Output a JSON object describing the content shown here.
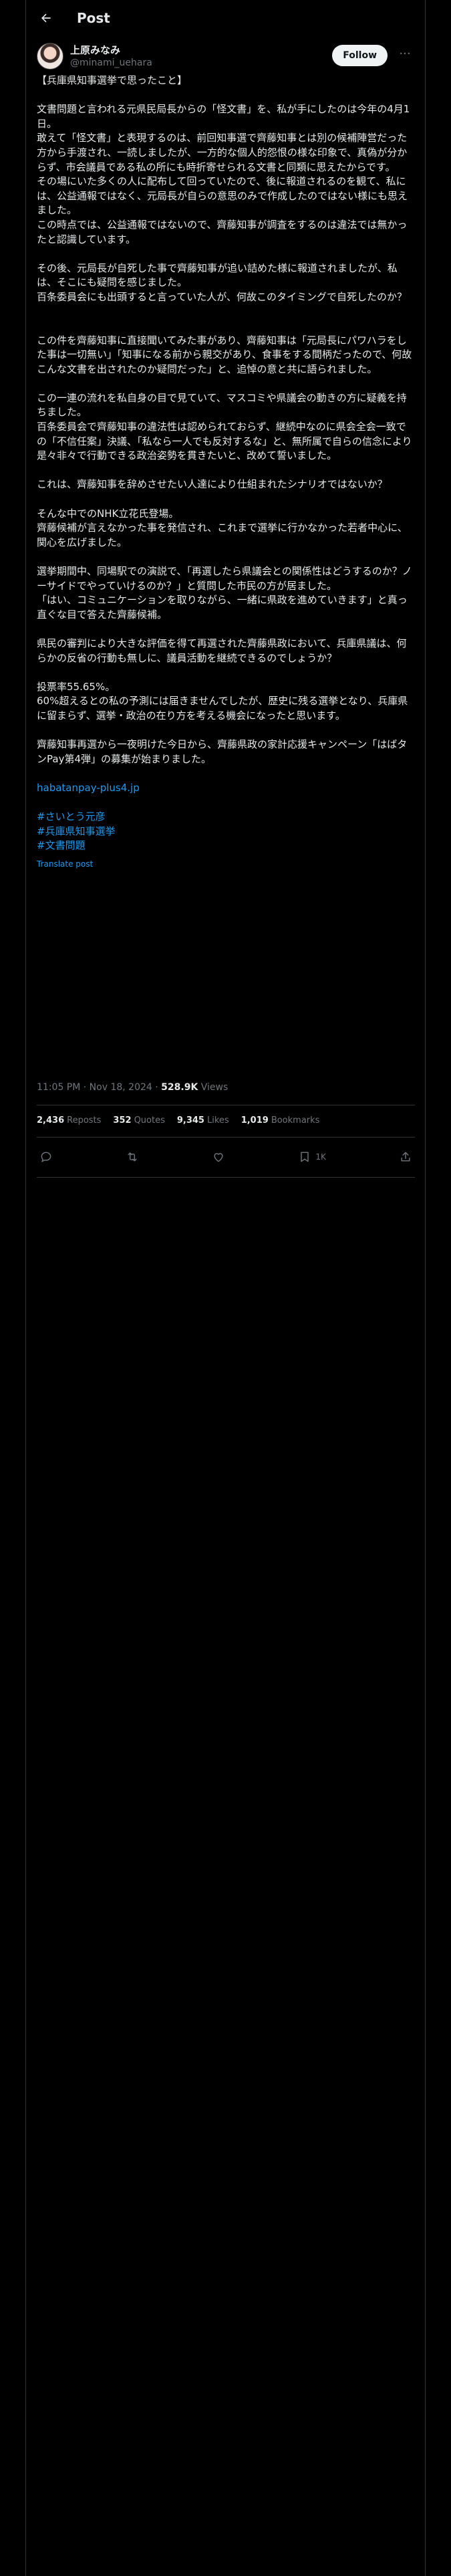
{
  "header": {
    "title": "Post"
  },
  "author": {
    "display_name": "上原みなみ",
    "handle": "@minami_uehara",
    "follow_label": "Follow",
    "more_label": "···"
  },
  "body": {
    "p1": "【兵庫県知事選挙で思ったこと】",
    "p2": "文書問題と言われる元県民局長からの「怪文書」を、私が手にしたのは今年の4月1日。\n敢えて「怪文書」と表現するのは、前回知事選で齊藤知事とは別の候補陣営だった方から手渡され、一読しましたが、一方的な個人的怨恨の様な印象で、真偽が分からず、市会議員である私の所にも時折寄せられる文書と同類に思えたからです。\nその場にいた多くの人に配布して回っていたので、後に報道されるのを観て、私には、公益通報ではなく、元局長が自らの意思のみで作成したのではない様にも思えました。\nこの時点では、公益通報ではないので、齊藤知事が調査をするのは違法では無かったと認識しています。",
    "p3": "その後、元局長が自死した事で齊藤知事が追い詰めた様に報道されましたが、私は、そこにも疑問を感じました。\n百条委員会にも出頭すると言っていた人が、何故このタイミングで自死したのか？",
    "p4": "この件を齊藤知事に直接聞いてみた事があり、齊藤知事は「元局長にパワハラをした事は一切無い」「知事になる前から親交があり、食事をする間柄だったので、何故こんな文書を出されたのか疑問だった」と、追悼の意と共に語られました。",
    "p5": "この一連の流れを私自身の目で見ていて、マスコミや県議会の動きの方に疑義を持ちました。\n百条委員会で齊藤知事の違法性は認められておらず、継続中なのに県会全会一致での「不信任案」決議、「私なら一人でも反対するな」と、無所属で自らの信念により是々非々で行動できる政治姿勢を貫きたいと、改めて誓いました。",
    "p6": "これは、齊藤知事を辞めさせたい人達により仕組まれたシナリオではないか？",
    "p7": "そんな中でのNHK立花氏登場。\n齊藤候補が言えなかった事を発信され、これまで選挙に行かなかった若者中心に、関心を広げました。",
    "p8": "選挙期間中、同場駅での演説で、「再選したら県議会との関係性はどうするのか？ノーサイドでやっていけるのか？」と質問した市民の方が居ました。\n「はい、コミュニケーションを取りながら、一緒に県政を進めていきます」と真っ直ぐな目で答えた齊藤候補。",
    "p9": "県民の審判により大きな評価を得て再選された齊藤県政において、兵庫県議は、何らかの反省の行動も無しに、議員活動を継続できるのでしょうか？",
    "p10": "投票率55.65%。\n60%超えるとの私の予測には届きませんでしたが、歴史に残る選挙となり、兵庫県に留まらず、選挙・政治の在り方を考える機会になったと思います。",
    "p11": "齊藤知事再選から一夜明けた今日から、齊藤県政の家計応援キャンペーン「はばタンPay第4弾」の募集が始まりました。",
    "link": "habatanpay-plus4.jp",
    "hashtags": [
      "#さいとう元彦",
      "#兵庫県知事選挙",
      "#文書問題"
    ],
    "translate": "Translate post"
  },
  "meta": {
    "time": "11:05 PM · Nov 18, 2024",
    "separator": " · ",
    "views_count": "528.9K",
    "views_label": "Views"
  },
  "stats": {
    "reposts_count": "2,436",
    "reposts_label": "Reposts",
    "quotes_count": "352",
    "quotes_label": "Quotes",
    "likes_count": "9,345",
    "likes_label": "Likes",
    "bookmarks_count": "1,019",
    "bookmarks_label": "Bookmarks"
  },
  "actions": {
    "bookmark_count": "1K"
  },
  "colors": {
    "background": "#000000",
    "text": "#e7e9ea",
    "muted": "#71767b",
    "accent": "#1d9bf0",
    "border": "#2f3336"
  }
}
